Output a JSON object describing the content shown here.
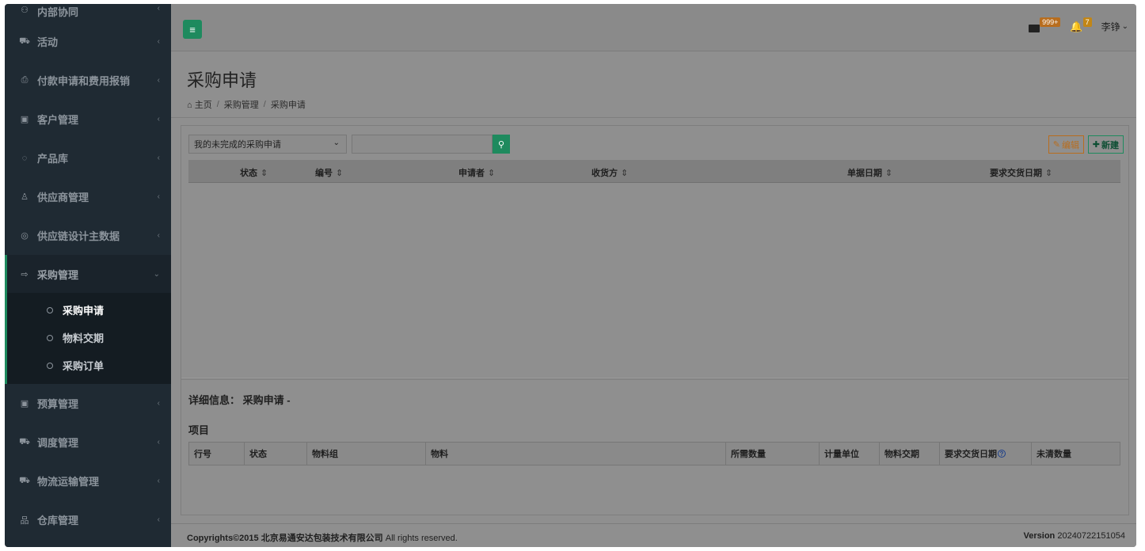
{
  "sidebar": {
    "items": [
      {
        "label": "内部协同",
        "icon": "users-icon",
        "glyph": "⚇"
      },
      {
        "label": "活动",
        "icon": "activity-icon",
        "glyph": "⛟"
      },
      {
        "label": "付款申请和费用报销",
        "icon": "payment-icon",
        "glyph": "⎙"
      },
      {
        "label": "客户管理",
        "icon": "customer-icon",
        "glyph": "▣"
      },
      {
        "label": "产品库",
        "icon": "product-icon",
        "glyph": "◌"
      },
      {
        "label": "供应商管理",
        "icon": "supplier-icon",
        "glyph": "♙"
      },
      {
        "label": "供应链设计主数据",
        "icon": "supply-chain-icon",
        "glyph": "◎"
      },
      {
        "label": "采购管理",
        "icon": "purchase-icon",
        "glyph": "⇨"
      },
      {
        "label": "预算管理",
        "icon": "budget-icon",
        "glyph": "▣"
      },
      {
        "label": "调度管理",
        "icon": "dispatch-icon",
        "glyph": "⛟"
      },
      {
        "label": "物流运输管理",
        "icon": "logistics-icon",
        "glyph": "⛟"
      },
      {
        "label": "仓库管理",
        "icon": "warehouse-icon",
        "glyph": "品"
      }
    ],
    "submenu": [
      {
        "label": "采购申请"
      },
      {
        "label": "物料交期"
      },
      {
        "label": "采购订单"
      }
    ],
    "arrow": "‹",
    "arrow_open": "⌄"
  },
  "topbar": {
    "menu_glyph": "≡",
    "mail_count": "999+",
    "bell_glyph": "🔔",
    "bell_count": "7",
    "user_name": "李铮",
    "caret": "⌄"
  },
  "header": {
    "title": "采购申请",
    "breadcrumb": [
      {
        "label": "主页",
        "icon": "home-icon",
        "glyph": "⌂"
      },
      {
        "label": "采购管理"
      },
      {
        "label": "采购申请"
      }
    ],
    "separator": "/"
  },
  "toolbar": {
    "filter_value": "我的未完成的采购申请",
    "filter_caret": "⌄",
    "search_placeholder": "",
    "search_glyph": "⚲",
    "edit_label": "编辑",
    "edit_glyph": "✎",
    "new_label": "新建",
    "new_glyph": "✚"
  },
  "grid": {
    "columns": [
      "状态",
      "编号",
      "申请者",
      "收货方",
      "单据日期",
      "要求交货日期"
    ],
    "sort_glyph": "⇕"
  },
  "detail": {
    "title": "详细信息：  采购申请 -",
    "items_title": "项目",
    "item_columns": [
      "行号",
      "状态",
      "物料组",
      "物料",
      "所需数量",
      "计量单位",
      "物料交期",
      "要求交货日期",
      "未清数量"
    ],
    "help_glyph": "?"
  },
  "footer": {
    "copyright_bold": "Copyrights©2015 北京易通安达包装技术有限公司",
    "copyright_rest": " All rights reserved.",
    "version_label": "Version",
    "version_value": " 20240722151054"
  },
  "colors": {
    "accent": "#1e8a5e",
    "sidebar_bg": "#1f2a33",
    "edit": "#b86d1e"
  }
}
